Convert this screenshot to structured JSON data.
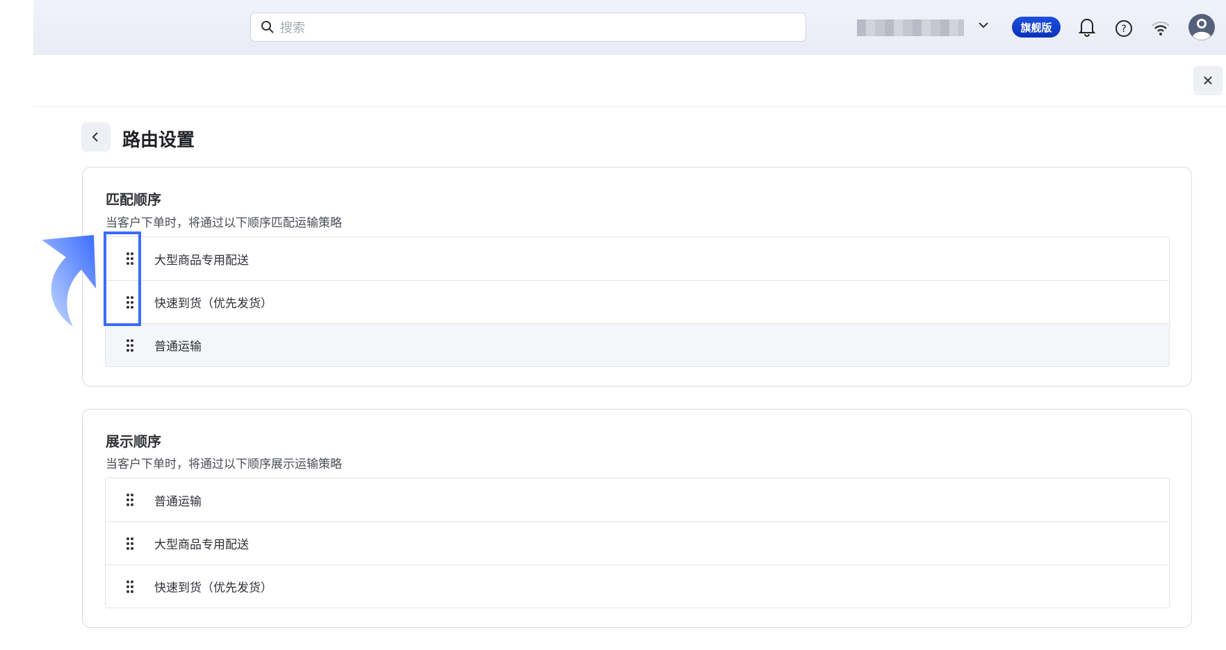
{
  "topbar": {
    "search_placeholder": "搜索",
    "plan_badge": "旗舰版"
  },
  "page": {
    "title": "路由设置"
  },
  "match_order": {
    "title": "匹配顺序",
    "description": "当客户下单时，将通过以下顺序匹配运输策略",
    "items": [
      {
        "label": "大型商品专用配送"
      },
      {
        "label": "快速到货（优先发货）"
      },
      {
        "label": "普通运输"
      }
    ]
  },
  "display_order": {
    "title": "展示顺序",
    "description": "当客户下单时，将通过以下顺序展示运输策略",
    "items": [
      {
        "label": "普通运输"
      },
      {
        "label": "大型商品专用配送"
      },
      {
        "label": "快速到货（优先发货）"
      }
    ]
  },
  "colors": {
    "accent": "#3a6cff",
    "badge": "#1d4fe0"
  }
}
